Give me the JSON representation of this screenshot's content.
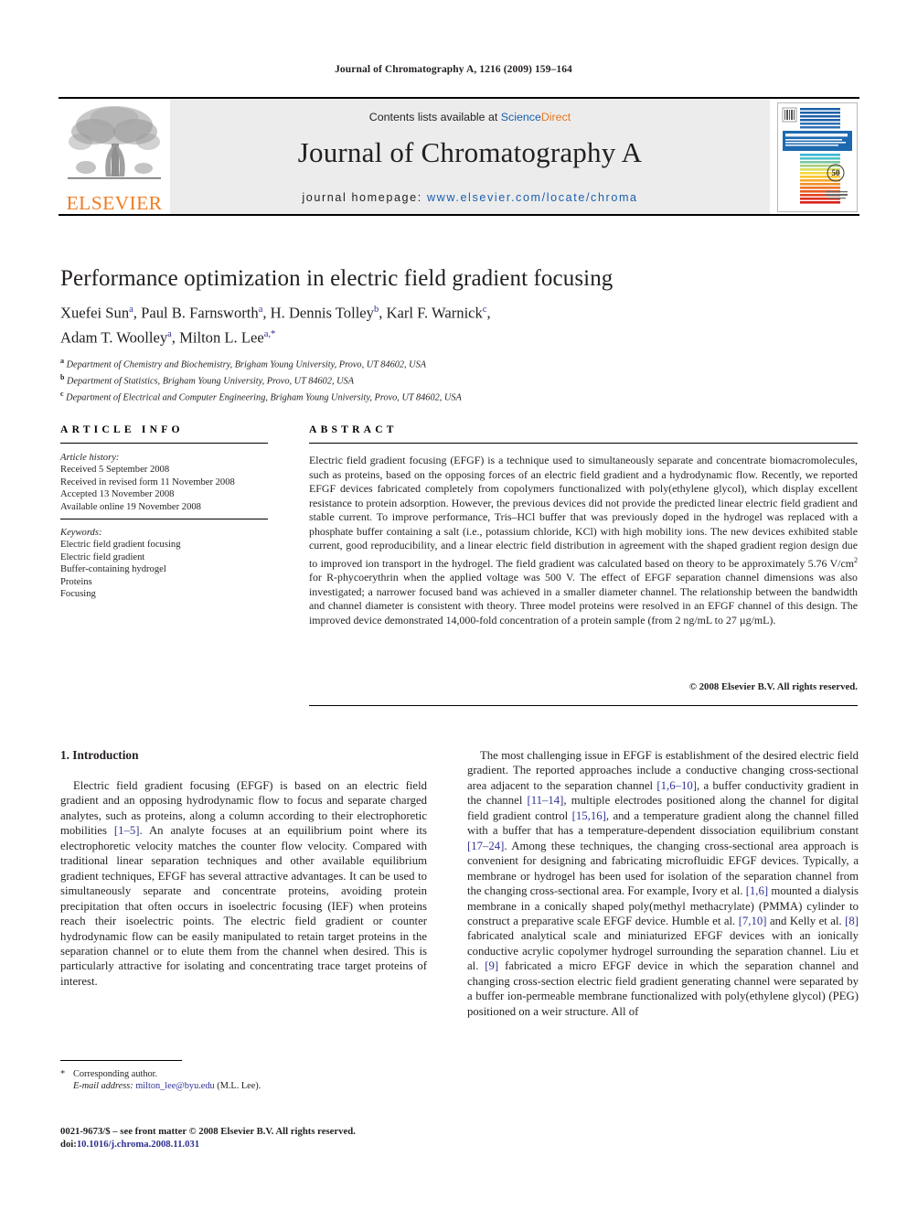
{
  "running_head": "Journal of Chromatography A, 1216 (2009) 159–164",
  "masthead": {
    "publisher": "ELSEVIER",
    "contents_prefix": "Contents lists available at ",
    "contents_science": "Science",
    "contents_direct": "Direct",
    "journal_title": "Journal of Chromatography A",
    "homepage_label": "journal homepage: ",
    "homepage_url": "www.elsevier.com/locate/chroma",
    "cover_title": "JOURNAL OF CHROMATOGRAPHY A",
    "cover_subtitle": "AN INTERNATIONAL JOURNAL ON SEPARATION SCIENCE AND RELATED TECHNIQUES",
    "cover_badge": "50",
    "cover_badge_sub": "YEARS",
    "cover_brand": "ScienceDirect"
  },
  "article": {
    "title": "Performance optimization in electric field gradient focusing",
    "authors_line1": "Xuefei Sun",
    "authors": [
      {
        "name": "Xuefei Sun",
        "marks": "a",
        "sep": ", "
      },
      {
        "name": "Paul B. Farnsworth",
        "marks": "a",
        "sep": ", "
      },
      {
        "name": "H. Dennis Tolley",
        "marks": "b",
        "sep": ", "
      },
      {
        "name": "Karl F. Warnick",
        "marks": "c",
        "sep": ","
      },
      {
        "name": "Adam T. Woolley",
        "marks": "a",
        "sep": ", "
      },
      {
        "name": "Milton L. Lee",
        "marks": "a,*",
        "sep": ""
      }
    ],
    "affiliations": [
      {
        "mark": "a",
        "text": "Department of Chemistry and Biochemistry, Brigham Young University, Provo, UT 84602, USA"
      },
      {
        "mark": "b",
        "text": "Department of Statistics, Brigham Young University, Provo, UT 84602, USA"
      },
      {
        "mark": "c",
        "text": "Department of Electrical and Computer Engineering, Brigham Young University, Provo, UT 84602, USA"
      }
    ]
  },
  "info_panel": {
    "heading": "ARTICLE INFO",
    "history_label": "Article history:",
    "history": [
      "Received 5 September 2008",
      "Received in revised form 11 November 2008",
      "Accepted 13 November 2008",
      "Available online 19 November 2008"
    ],
    "keywords_label": "Keywords:",
    "keywords": [
      "Electric field gradient focusing",
      "Electric field gradient",
      "Buffer-containing hydrogel",
      "Proteins",
      "Focusing"
    ]
  },
  "abstract_panel": {
    "heading": "ABSTRACT",
    "text": "Electric field gradient focusing (EFGF) is a technique used to simultaneously separate and concentrate biomacromolecules, such as proteins, based on the opposing forces of an electric field gradient and a hydrodynamic flow. Recently, we reported EFGF devices fabricated completely from copolymers functionalized with poly(ethylene glycol), which display excellent resistance to protein adsorption. However, the previous devices did not provide the predicted linear electric field gradient and stable current. To improve performance, Tris–HCl buffer that was previously doped in the hydrogel was replaced with a phosphate buffer containing a salt (i.e., potassium chloride, KCl) with high mobility ions. The new devices exhibited stable current, good reproducibility, and a linear electric field distribution in agreement with the shaped gradient region design due to improved ion transport in the hydrogel. The field gradient was calculated based on theory to be approximately 5.76 V/cm",
    "text_sup": "2",
    "text_after_sup": " for R-phycoerythrin when the applied voltage was 500 V. The effect of EFGF separation channel dimensions was also investigated; a narrower focused band was achieved in a smaller diameter channel. The relationship between the bandwidth and channel diameter is consistent with theory. Three model proteins were resolved in an EFGF channel of this design. The improved device demonstrated 14,000-fold concentration of a protein sample (from 2 ng/mL to 27 µg/mL).",
    "copyright": "© 2008 Elsevier B.V. All rights reserved."
  },
  "body": {
    "section_number_title": "1.  Introduction",
    "left_paragraph_1a": "Electric field gradient focusing (EFGF) is based on an electric field gradient and an opposing hydrodynamic flow to focus and separate charged analytes, such as proteins, along a column according to their electrophoretic mobilities ",
    "left_ref_1": "[1–5]",
    "left_paragraph_1b": ". An analyte focuses at an equilibrium point where its electrophoretic velocity matches the counter flow velocity. Compared with traditional linear separation techniques and other available equilibrium gradient techniques, EFGF has several attractive advantages. It can be used to simultaneously separate and concentrate proteins, avoiding protein precipitation that often occurs in isoelectric focusing (IEF) when proteins reach their isoelectric points. The electric field gradient or counter hydrodynamic flow can be easily manipulated to retain target proteins in the separation channel or to elute them from the channel when desired. This is particularly attractive for isolating and concentrating trace target proteins of interest.",
    "right_p1_a": "The most challenging issue in EFGF is establishment of the desired electric field gradient. The reported approaches include a conductive changing cross-sectional area adjacent to the separation channel ",
    "right_ref_1": "[1,6–10]",
    "right_p1_b": ", a buffer conductivity gradient in the channel ",
    "right_ref_2": "[11–14]",
    "right_p1_c": ", multiple electrodes positioned along the channel for digital field gradient control ",
    "right_ref_3": "[15,16]",
    "right_p1_d": ", and a temperature gradient along the channel filled with a buffer that has a temperature-dependent dissociation equilibrium constant ",
    "right_ref_4": "[17–24]",
    "right_p1_e": ". Among these techniques, the changing cross-sectional area approach is convenient for designing and fabricating microfluidic EFGF devices. Typically, a membrane or hydrogel has been used for isolation of the separation channel from the changing cross-sectional area. For example, Ivory et al. ",
    "right_ref_5": "[1,6]",
    "right_p1_f": " mounted a dialysis membrane in a conically shaped poly(methyl methacrylate) (PMMA) cylinder to construct a preparative scale EFGF device. Humble et al. ",
    "right_ref_6": "[7,10]",
    "right_p1_g": " and Kelly et al. ",
    "right_ref_7": "[8]",
    "right_p1_h": " fabricated analytical scale and miniaturized EFGF devices with an ionically conductive acrylic copolymer hydrogel surrounding the separation channel. Liu et al. ",
    "right_ref_8": "[9]",
    "right_p1_i": " fabricated a micro EFGF device in which the separation channel and changing cross-section electric field gradient generating channel were separated by a buffer ion-permeable membrane functionalized with poly(ethylene glycol) (PEG) positioned on a weir structure. All of"
  },
  "footer": {
    "corresponding_label": "Corresponding author.",
    "email_label": "E-mail address:",
    "email": "milton_lee@byu.edu",
    "email_suffix": " (M.L. Lee).",
    "issn_line": "0021-9673/$ – see front matter © 2008 Elsevier B.V. All rights reserved.",
    "doi_label": "doi:",
    "doi": "10.1016/j.chroma.2008.11.031"
  },
  "colors": {
    "link": "#2e3192",
    "elsevier_orange": "#ef7c22",
    "sciencedirect_blue": "#1b5fae",
    "sciencedirect_orange": "#e87722",
    "mast_gray": "#ececec"
  }
}
